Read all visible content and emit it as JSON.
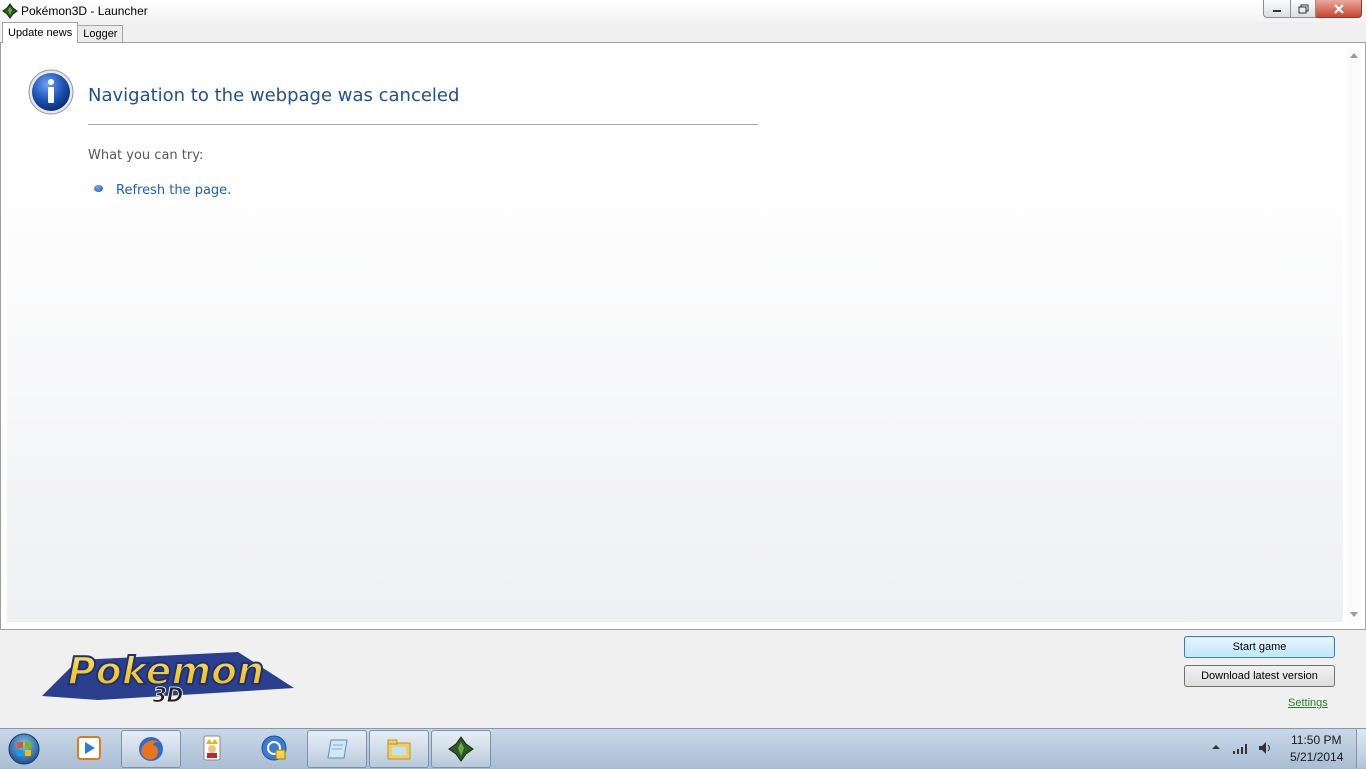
{
  "window": {
    "title": "Pokémon3D - Launcher",
    "controls": {
      "minimize": "minimize-icon",
      "maximize": "restore-icon",
      "close": "close-icon"
    }
  },
  "tabs": [
    {
      "label": "Update news",
      "active": true
    },
    {
      "label": "Logger",
      "active": false
    }
  ],
  "browser": {
    "heading": "Navigation to the webpage was canceled",
    "try_label": "What you can try:",
    "suggestions": [
      {
        "label": "Refresh the page."
      }
    ],
    "icon": "info-icon"
  },
  "footer": {
    "logo_main": "Pokemon",
    "logo_sub": "3D",
    "start_button": "Start game",
    "download_button": "Download latest version",
    "settings_link": "Settings"
  },
  "taskbar": {
    "items": [
      {
        "name": "media-player-icon"
      },
      {
        "name": "firefox-icon"
      },
      {
        "name": "king-card-icon"
      },
      {
        "name": "network-center-icon"
      },
      {
        "name": "notepad-icon"
      },
      {
        "name": "file-explorer-icon"
      },
      {
        "name": "pokemon3d-icon"
      }
    ],
    "clock": {
      "time": "11:50 PM",
      "date": "5/21/2014"
    }
  },
  "colors": {
    "heading": "#1f4f98",
    "link": "#1e5fb3",
    "settings_link": "#2d7d2d",
    "start_button": "#bee6fd"
  }
}
